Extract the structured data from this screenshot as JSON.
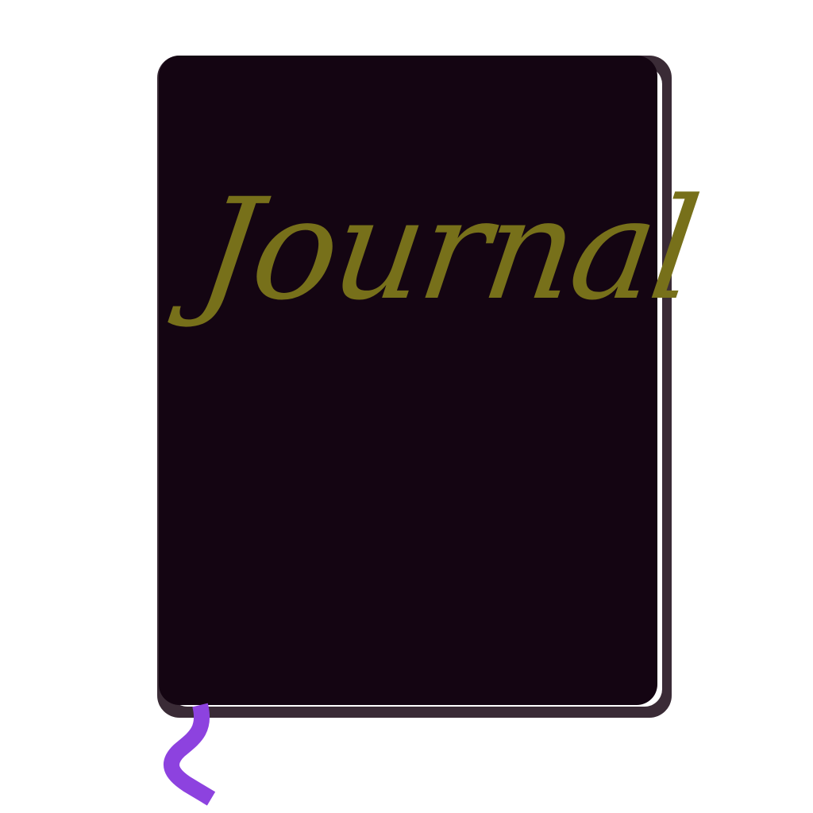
{
  "journal": {
    "title": "Journal"
  },
  "colors": {
    "background": "#ffffff",
    "cover": "#140512",
    "back_board": "#3a2b36",
    "pages": "#ffffff",
    "title": "#77701a",
    "ribbon": "#8d42df"
  },
  "icons": {
    "bookmark": "bookmark-ribbon-icon"
  }
}
